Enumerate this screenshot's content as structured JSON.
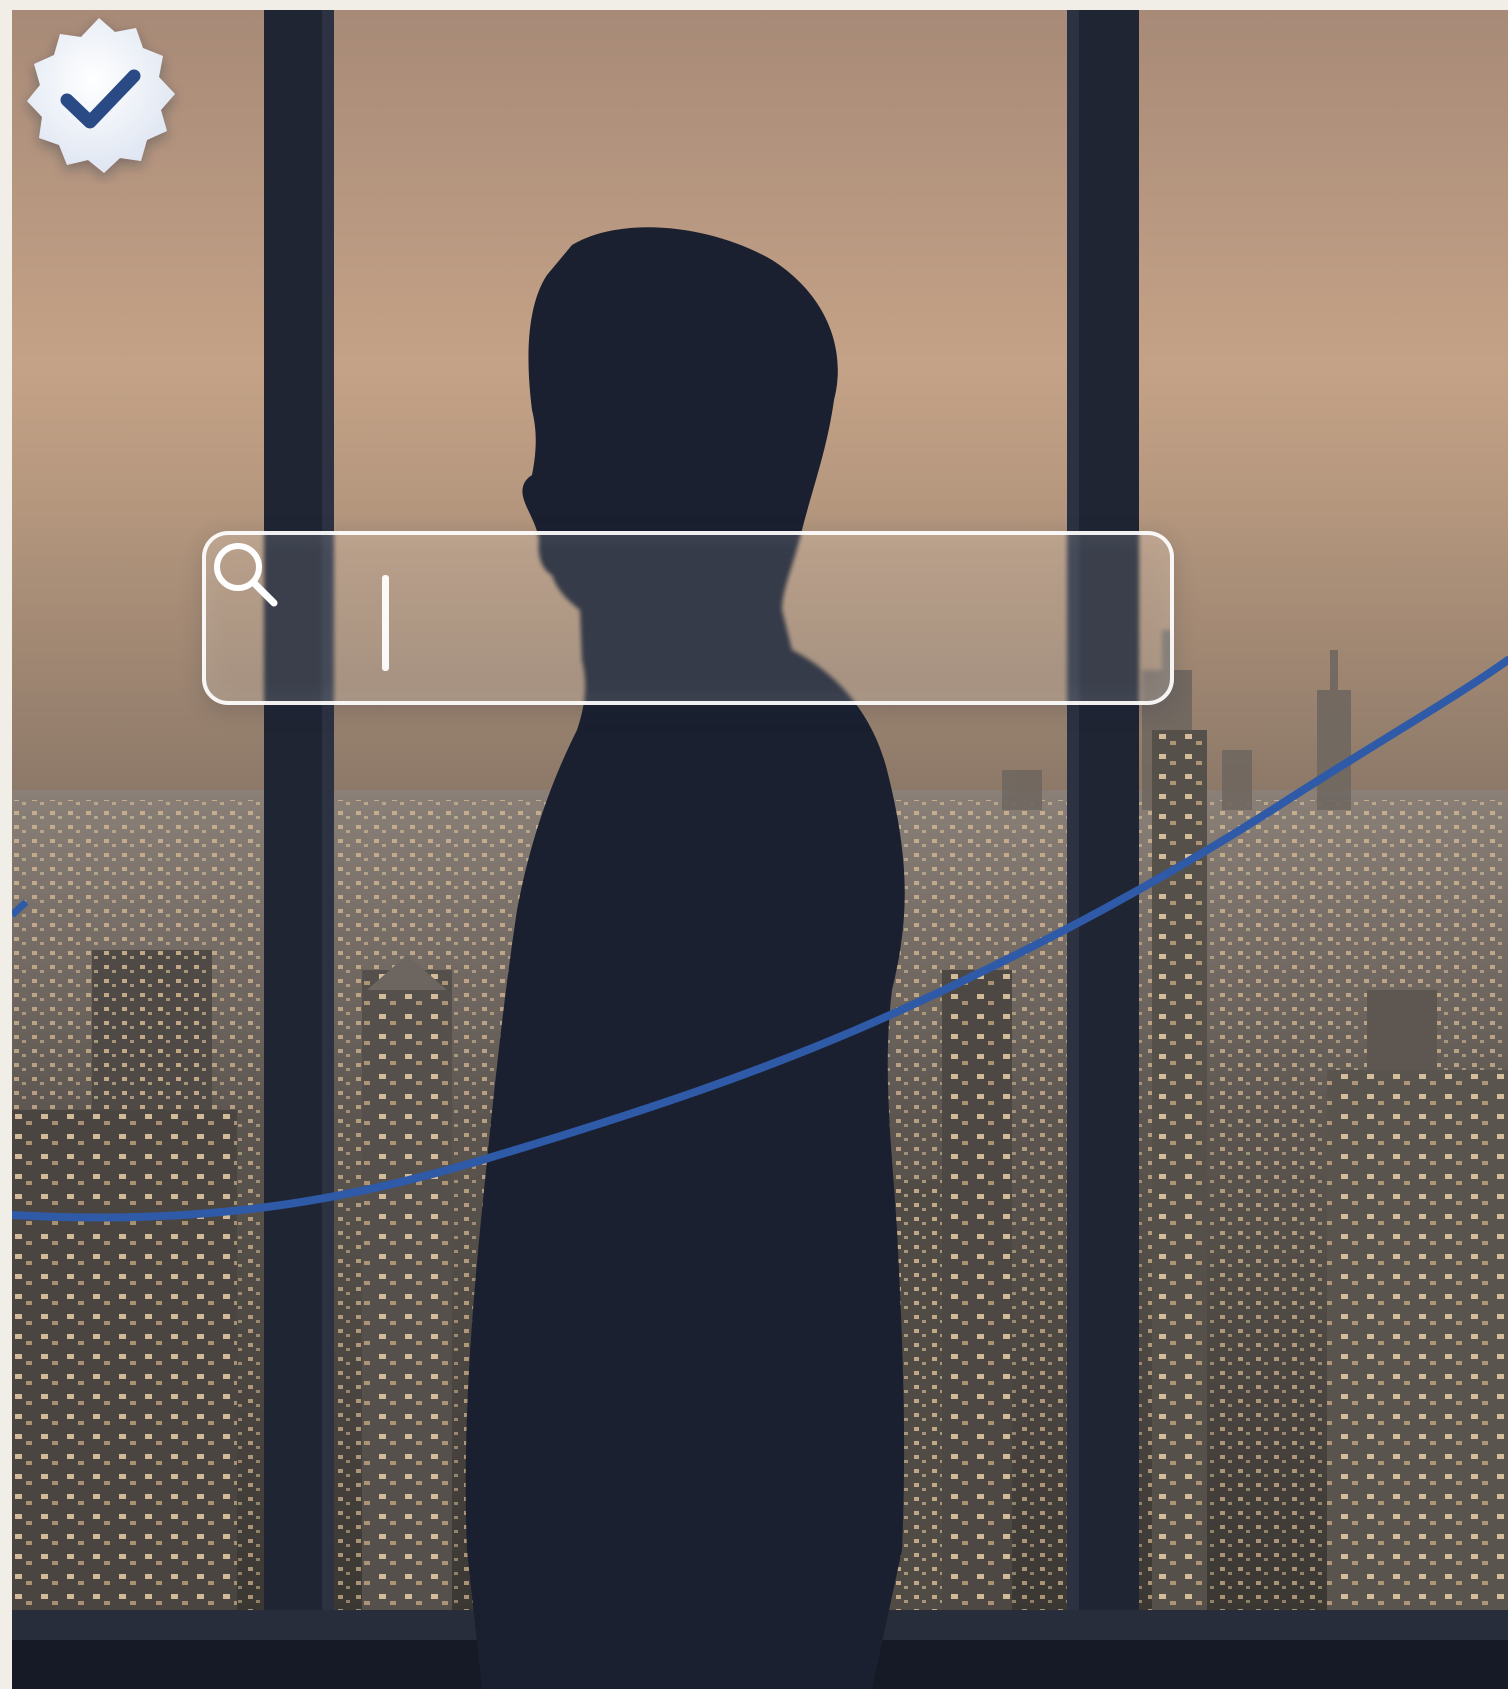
{
  "scene": {
    "description_hidden": "",
    "accent_line_color": "#2f5aa8",
    "sky_color": "#c6a58a",
    "frame_color": "#1d2433"
  },
  "search": {
    "value": "",
    "placeholder": ""
  },
  "badge": {
    "icon": "verified-check-icon",
    "fill": "#eef3fb",
    "check_color": "#2a4a85"
  }
}
